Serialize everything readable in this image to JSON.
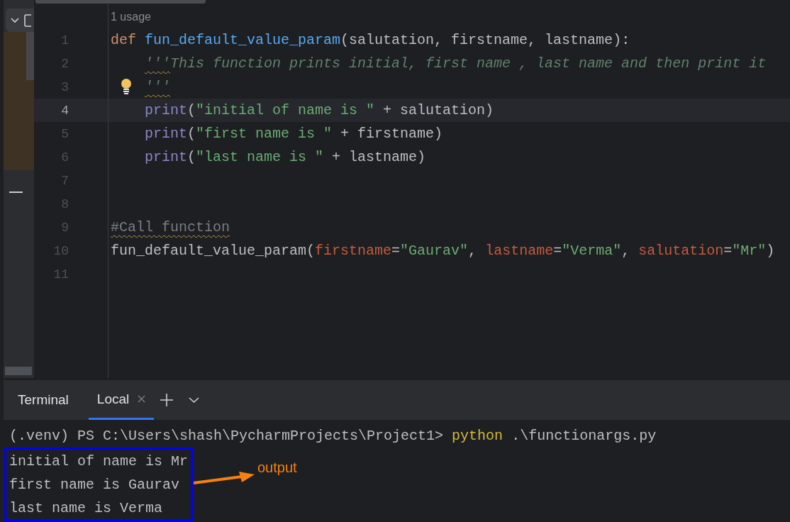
{
  "editor": {
    "usages": "1 usage",
    "lines": [
      {
        "number": "1",
        "indented": false,
        "current": false,
        "hint": false,
        "tokens": [
          {
            "kind": "keyword",
            "text": "def "
          },
          {
            "kind": "function",
            "text": "fun_default_value_param"
          },
          {
            "kind": "text",
            "text": "(salutation, firstname, lastname):"
          }
        ]
      },
      {
        "number": "2",
        "indented": true,
        "current": false,
        "hint": false,
        "tokens": [
          {
            "kind": "docstring",
            "text": "'''",
            "warning": true
          },
          {
            "kind": "docstring",
            "text": "This function prints initial, first name , last name and then print it"
          }
        ]
      },
      {
        "number": "3",
        "indented": true,
        "current": false,
        "hint": true,
        "tokens": [
          {
            "kind": "docstring",
            "text": "'''",
            "warning": true
          }
        ]
      },
      {
        "number": "4",
        "indented": true,
        "current": true,
        "hint": false,
        "tokens": [
          {
            "kind": "builtin",
            "text": "print"
          },
          {
            "kind": "text",
            "text": "("
          },
          {
            "kind": "string",
            "text": "\"initial of name is \""
          },
          {
            "kind": "text",
            "text": " + salutation)"
          }
        ]
      },
      {
        "number": "5",
        "indented": true,
        "current": false,
        "hint": false,
        "tokens": [
          {
            "kind": "builtin",
            "text": "print"
          },
          {
            "kind": "text",
            "text": "("
          },
          {
            "kind": "string",
            "text": "\"first name is \""
          },
          {
            "kind": "text",
            "text": " + firstname)"
          }
        ]
      },
      {
        "number": "6",
        "indented": true,
        "current": false,
        "hint": false,
        "tokens": [
          {
            "kind": "builtin",
            "text": "print"
          },
          {
            "kind": "text",
            "text": "("
          },
          {
            "kind": "string",
            "text": "\"last name is \""
          },
          {
            "kind": "text",
            "text": " + lastname)"
          }
        ]
      },
      {
        "number": "7",
        "indented": false,
        "current": false,
        "hint": false
      },
      {
        "number": "8",
        "indented": false,
        "current": false,
        "hint": false
      },
      {
        "number": "9",
        "indented": false,
        "current": false,
        "hint": false,
        "tokens": [
          {
            "kind": "comment",
            "text": "#Call function",
            "warning": true
          }
        ]
      },
      {
        "number": "10",
        "indented": false,
        "current": false,
        "hint": false,
        "tokens": [
          {
            "kind": "text",
            "text": "fun_default_value_param("
          },
          {
            "kind": "param",
            "text": "firstname"
          },
          {
            "kind": "text",
            "text": "="
          },
          {
            "kind": "string",
            "text": "\"Gaurav\""
          },
          {
            "kind": "text",
            "text": ", "
          },
          {
            "kind": "param",
            "text": "lastname"
          },
          {
            "kind": "text",
            "text": "="
          },
          {
            "kind": "string",
            "text": "\"Verma\""
          },
          {
            "kind": "text",
            "text": ", "
          },
          {
            "kind": "param",
            "text": "salutation"
          },
          {
            "kind": "text",
            "text": "="
          },
          {
            "kind": "string",
            "text": "\"Mr\""
          },
          {
            "kind": "text",
            "text": ")"
          }
        ]
      },
      {
        "number": "11",
        "indented": false,
        "current": false,
        "hint": false
      }
    ]
  },
  "terminal": {
    "title": "Terminal",
    "tabs": [
      {
        "label": "Local",
        "selected": true
      }
    ],
    "command": {
      "prompt": "(.venv) PS C:\\Users\\shash\\PycharmProjects\\Project1> ",
      "program": "python",
      "args": " .\\functionargs.py"
    },
    "output": [
      "initial of name is Mr",
      "first name is Gaurav",
      "last name is Verma"
    ],
    "annotation": {
      "label": "output"
    }
  }
}
